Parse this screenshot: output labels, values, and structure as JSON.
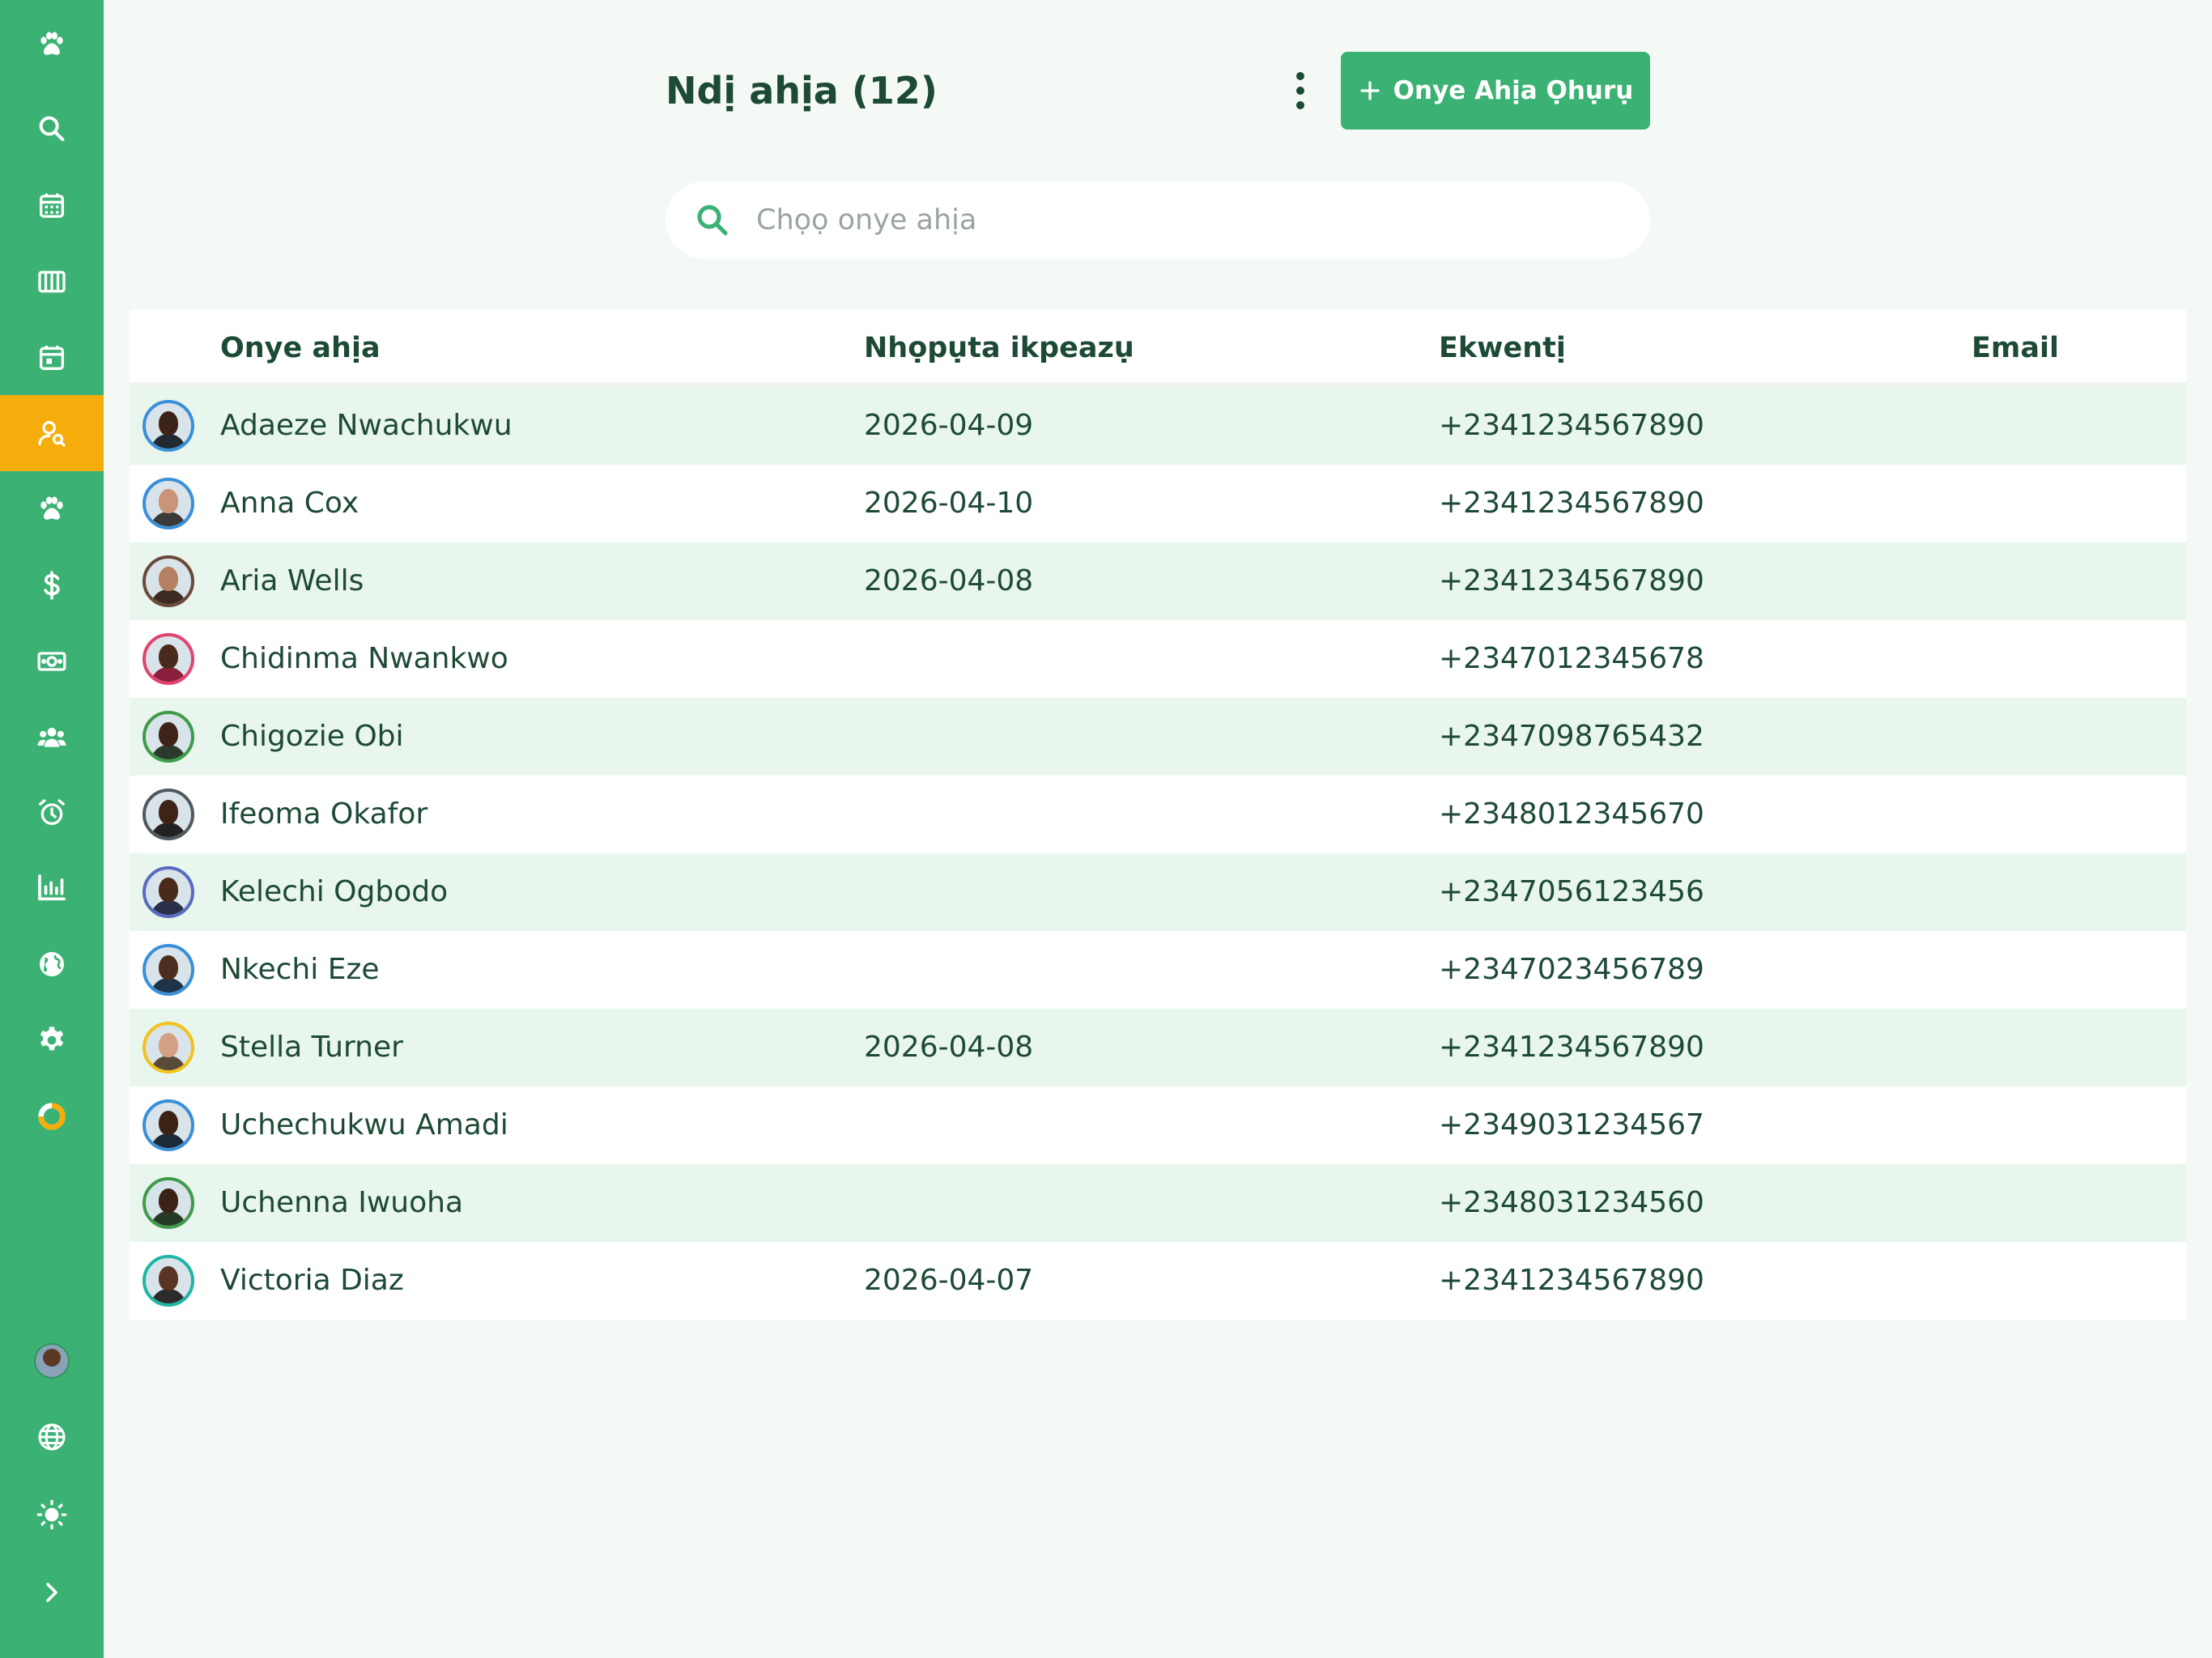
{
  "sidebar": {
    "items": [
      {
        "icon": "paw-icon",
        "name": "nav-logo"
      },
      {
        "icon": "search-icon",
        "name": "nav-search"
      },
      {
        "icon": "calendar-grid-icon",
        "name": "nav-calendar"
      },
      {
        "icon": "columns-icon",
        "name": "nav-board"
      },
      {
        "icon": "calendar-day-icon",
        "name": "nav-appointments"
      },
      {
        "icon": "user-search-icon",
        "name": "nav-customers",
        "active": true
      },
      {
        "icon": "paw-icon",
        "name": "nav-pets"
      },
      {
        "icon": "dollar-icon",
        "name": "nav-billing"
      },
      {
        "icon": "cash-icon",
        "name": "nav-payments"
      },
      {
        "icon": "team-icon",
        "name": "nav-staff"
      },
      {
        "icon": "alarm-icon",
        "name": "nav-reminders"
      },
      {
        "icon": "bar-chart-icon",
        "name": "nav-reports"
      },
      {
        "icon": "globe-icon",
        "name": "nav-website"
      },
      {
        "icon": "gear-icon",
        "name": "nav-settings"
      },
      {
        "icon": "donut-progress-icon",
        "name": "nav-setup-progress"
      }
    ],
    "bottom": [
      {
        "icon": "avatar",
        "name": "nav-profile"
      },
      {
        "icon": "globe-outline-icon",
        "name": "nav-language"
      },
      {
        "icon": "sun-icon",
        "name": "nav-theme"
      },
      {
        "icon": "chevron-right-icon",
        "name": "nav-expand"
      }
    ]
  },
  "header": {
    "title": "Ndị ahịa (12)",
    "add_button_label": "Onye Ahịa Ọhụrụ"
  },
  "search": {
    "placeholder": "Chọọ onye ahịa",
    "value": ""
  },
  "table": {
    "columns": [
      "Onye ahịa",
      "Nhọpụta ikpeazụ",
      "Ekwentị",
      "Email"
    ],
    "rows": [
      {
        "name": "Adaeze Nwachukwu",
        "last_appointment": "2026-04-09",
        "phone": "+2341234567890",
        "email": "",
        "ring": "#3a8fd9",
        "skin": "#3b2417",
        "shirt": "#1f2a33"
      },
      {
        "name": "Anna Cox",
        "last_appointment": "2026-04-10",
        "phone": "+2341234567890",
        "email": "",
        "ring": "#3a8fd9",
        "skin": "#c99478",
        "shirt": "#3a3a3a"
      },
      {
        "name": "Aria Wells",
        "last_appointment": "2026-04-08",
        "phone": "+2341234567890",
        "email": "",
        "ring": "#6b4a3a",
        "skin": "#b57f62",
        "shirt": "#3d2a22"
      },
      {
        "name": "Chidinma Nwankwo",
        "last_appointment": "",
        "phone": "+2347012345678",
        "email": "",
        "ring": "#e0446f",
        "skin": "#4a2a1c",
        "shirt": "#8a1f3d"
      },
      {
        "name": "Chigozie Obi",
        "last_appointment": "",
        "phone": "+2347098765432",
        "email": "",
        "ring": "#3f9b4a",
        "skin": "#3e2418",
        "shirt": "#2b3a2c"
      },
      {
        "name": "Ifeoma Okafor",
        "last_appointment": "",
        "phone": "+2348012345670",
        "email": "",
        "ring": "#4f5a5e",
        "skin": "#3d2417",
        "shirt": "#222222"
      },
      {
        "name": "Kelechi Ogbodo",
        "last_appointment": "",
        "phone": "+2347056123456",
        "email": "",
        "ring": "#5a6bc0",
        "skin": "#4a2b1b",
        "shirt": "#2a2f4a"
      },
      {
        "name": "Nkechi Eze",
        "last_appointment": "",
        "phone": "+2347023456789",
        "email": "",
        "ring": "#3a8fd9",
        "skin": "#4d2d1d",
        "shirt": "#1f3347"
      },
      {
        "name": "Stella Turner",
        "last_appointment": "2026-04-08",
        "phone": "+2341234567890",
        "email": "",
        "ring": "#f2c21a",
        "skin": "#d3a085",
        "shirt": "#5a4a3a"
      },
      {
        "name": "Uchechukwu Amadi",
        "last_appointment": "",
        "phone": "+2349031234567",
        "email": "",
        "ring": "#3a8fd9",
        "skin": "#3b2215",
        "shirt": "#1d2b38"
      },
      {
        "name": "Uchenna Iwuoha",
        "last_appointment": "",
        "phone": "+2348031234560",
        "email": "",
        "ring": "#3f9b4a",
        "skin": "#3a2216",
        "shirt": "#263a26"
      },
      {
        "name": "Victoria Diaz",
        "last_appointment": "2026-04-07",
        "phone": "+2341234567890",
        "email": "",
        "ring": "#1fb5a6",
        "skin": "#5a3524",
        "shirt": "#2b2b2b"
      }
    ]
  },
  "colors": {
    "primary": "#3bb273",
    "active_nav": "#f5ad0b",
    "text": "#1d4a34",
    "row_alt": "#e8f6ee",
    "background": "#f4f9f5"
  }
}
